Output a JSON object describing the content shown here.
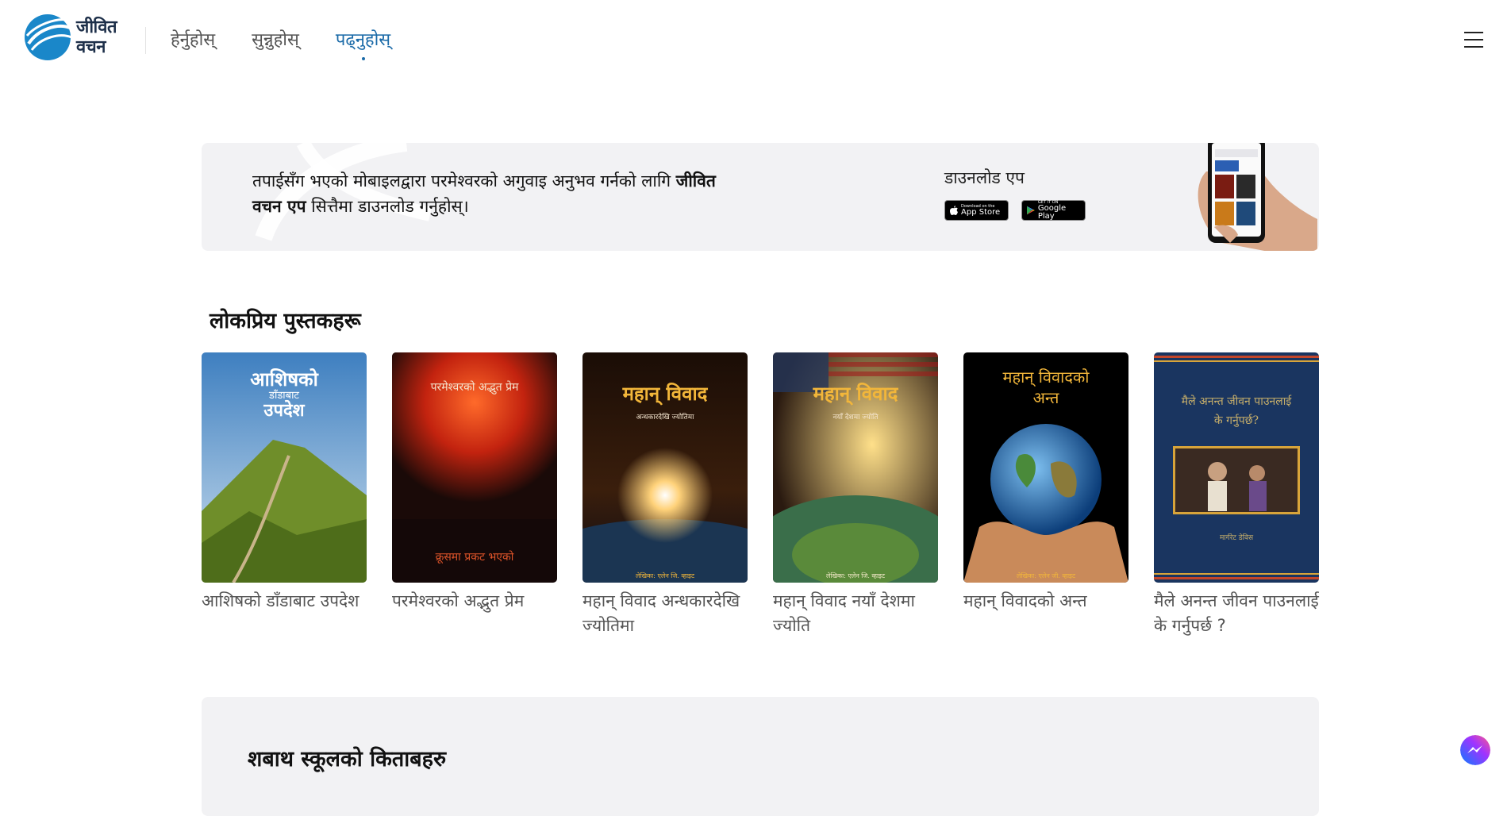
{
  "header": {
    "logo_line1": "जीवित",
    "logo_line2": "वचन",
    "nav": [
      {
        "label": "हेर्नुहोस्",
        "active": false
      },
      {
        "label": "सुन्नुहोस्",
        "active": false
      },
      {
        "label": "पढ्नुहोस्",
        "active": true
      }
    ]
  },
  "banner": {
    "text_before": "तपाईसँग भएको मोबाइलद्वारा परमेश्वरको अगुवाइ अनुभव गर्नको लागि ",
    "text_bold": "जीवित वचन एप",
    "text_after": " सित्तैमा डाउनलोड गर्नुहोस्।",
    "download_label": "डाउनलोड एप",
    "app_store": {
      "small": "Download on the",
      "big": "App Store"
    },
    "google_play": {
      "small": "GET IT ON",
      "big": "Google Play"
    }
  },
  "popular": {
    "title": "लोकप्रिय पुस्तकहरू",
    "books": [
      {
        "title": "आशिषको डाँडाबाट उपदेश",
        "cover_line1": "आशिषको",
        "cover_line2": "डाँडाबाट",
        "cover_line3": "उपदेश"
      },
      {
        "title": "परमेश्वरको अद्भुत प्रेम",
        "cover_line1": "परमेश्वरको अद्भुत प्रेम",
        "cover_line2": "क्रूसमा प्रकट भएको"
      },
      {
        "title": "महान् विवाद अन्धकारदेखि ज्योतिमा",
        "cover_line1": "महान् विवाद",
        "cover_line2": "अन्धकारदेखि ज्योतिमा",
        "cover_line3": "लेखिका: एलेन जि. व्हाइट"
      },
      {
        "title": "महान् विवाद नयाँ देशमा ज्योति",
        "cover_line1": "महान् विवाद",
        "cover_line2": "नयाँ देशमा ज्योति",
        "cover_line3": "लेखिका: एलेन जि. व्हाइट"
      },
      {
        "title": "महान् विवादको अन्त",
        "cover_line1": "महान् विवादको",
        "cover_line2": "अन्त",
        "cover_line3": "लेखिका: एलेन जी. व्हाइट"
      },
      {
        "title": "मैले अनन्त जीवन पाउनलाई के गर्नुपर्छ ?",
        "cover_line1": "मैले अनन्त जीवन पाउनलाई",
        "cover_line2": "के गर्नुपर्छ?",
        "cover_line3": "मार्गरेट डेविस"
      }
    ]
  },
  "sabbath": {
    "title": "शबाथ स्कूलको किताबहरु"
  }
}
